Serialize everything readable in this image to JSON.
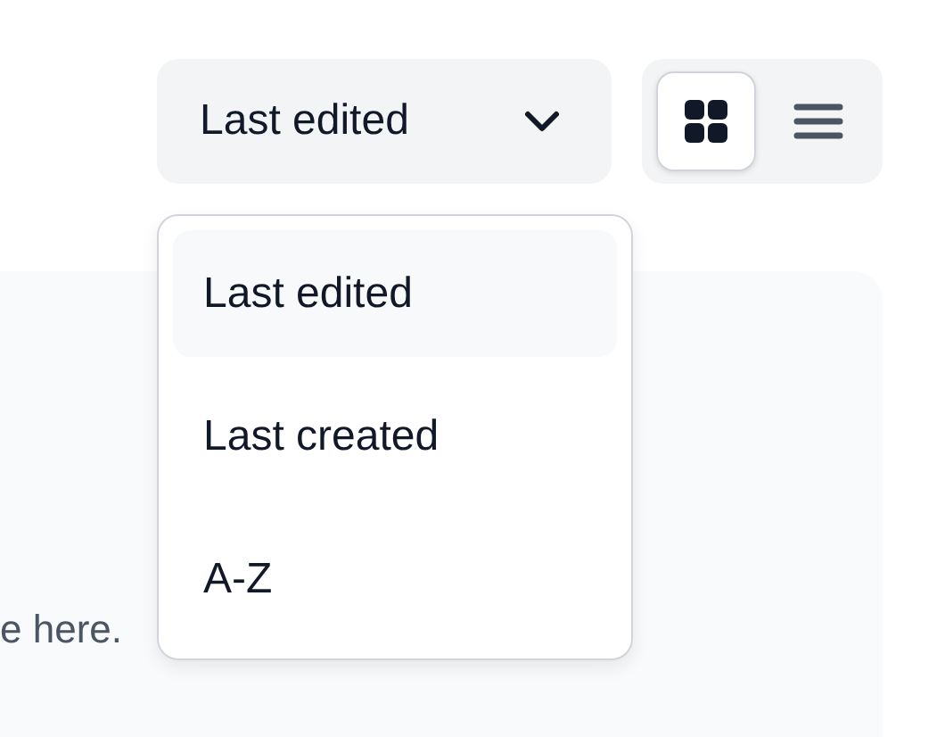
{
  "sort": {
    "label": "Last edited",
    "expanded": true
  },
  "sort_options": [
    {
      "label": "Last edited",
      "selected": true
    },
    {
      "label": "Last created",
      "selected": false
    },
    {
      "label": "A-Z",
      "selected": false
    }
  ],
  "view_toggle": [
    {
      "kind": "grid",
      "selected": true
    },
    {
      "kind": "list",
      "selected": false
    }
  ],
  "panel": {
    "text": "e here."
  }
}
